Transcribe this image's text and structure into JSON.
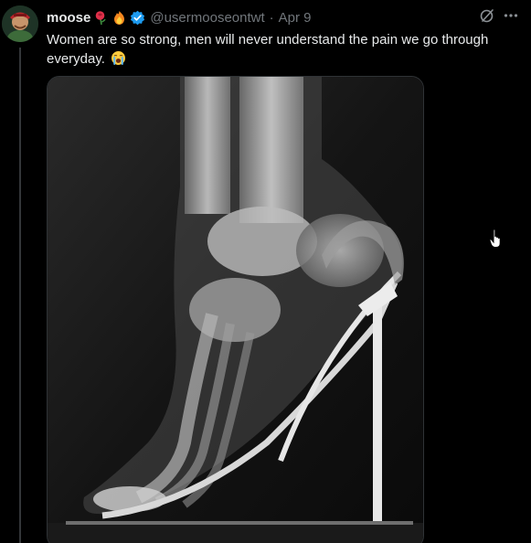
{
  "tweet": {
    "display_name": "moose",
    "badge_emojis": [
      "rose-icon",
      "fire-icon"
    ],
    "verified": true,
    "handle": "@usermooseontwt",
    "separator": "·",
    "date": "Apr 9",
    "text": "Women are so strong, men will never understand the pain we go through everyday.",
    "text_emoji": "loudly-crying-face-icon",
    "media": {
      "alt": "X-ray of a foot inside a high-heeled shoe"
    }
  },
  "icons": {
    "grok": "grok-icon",
    "more": "more-icon"
  },
  "colors": {
    "background": "#000000",
    "text": "#e7e9ea",
    "muted": "#71767b",
    "verified": "#1d9bf0",
    "border": "#2f3336"
  }
}
